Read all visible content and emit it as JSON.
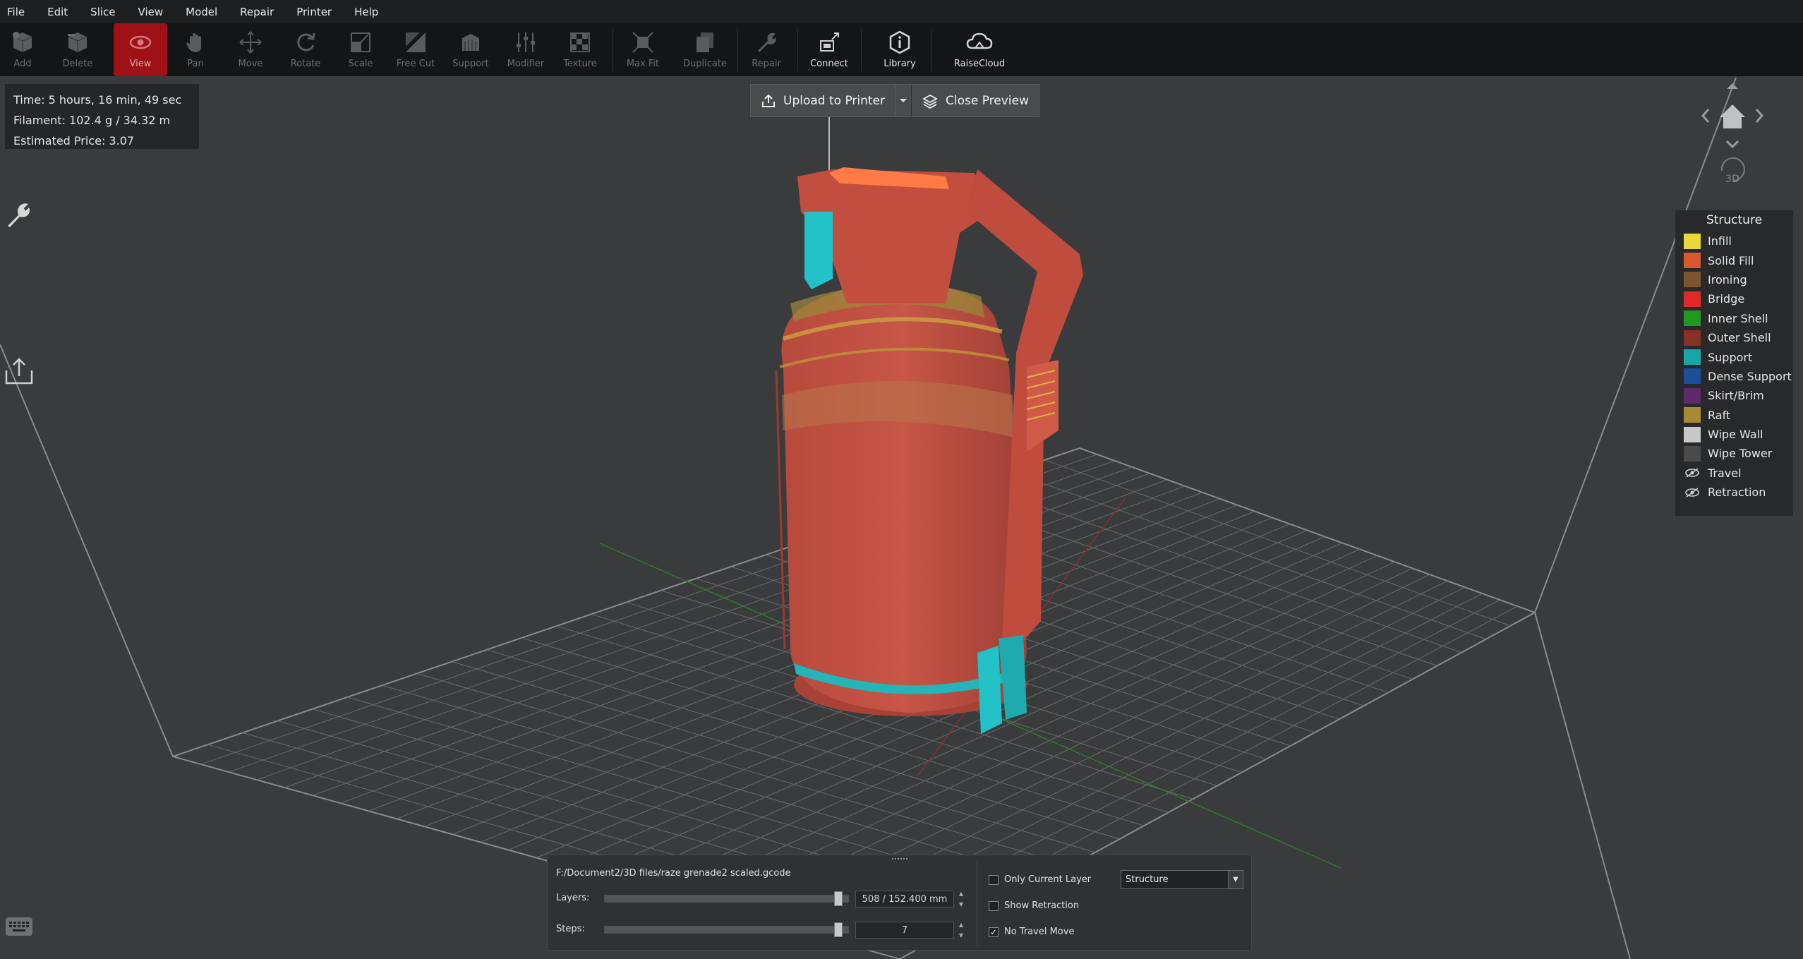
{
  "menu": [
    "File",
    "Edit",
    "Slice",
    "View",
    "Model",
    "Repair",
    "Printer",
    "Help"
  ],
  "toolbar": {
    "tools": [
      {
        "name": "add",
        "label": "Add",
        "icon": "add-cube-icon"
      },
      {
        "name": "delete",
        "label": "Delete",
        "icon": "delete-cube-icon"
      },
      {
        "name": "view",
        "label": "View",
        "icon": "eye-icon"
      },
      {
        "name": "pan",
        "label": "Pan",
        "icon": "hand-icon"
      },
      {
        "name": "move",
        "label": "Move",
        "icon": "move-arrows-icon"
      },
      {
        "name": "rotate",
        "label": "Rotate",
        "icon": "rotate-icon"
      },
      {
        "name": "scale",
        "label": "Scale",
        "icon": "scale-icon"
      },
      {
        "name": "free-cut",
        "label": "Free Cut",
        "icon": "cut-icon"
      },
      {
        "name": "support",
        "label": "Support",
        "icon": "support-icon"
      },
      {
        "name": "modifier",
        "label": "Modifier",
        "icon": "sliders-icon"
      },
      {
        "name": "texture",
        "label": "Texture",
        "icon": "texture-icon"
      },
      {
        "name": "max-fit",
        "label": "Max Fit",
        "icon": "max-fit-icon"
      },
      {
        "name": "duplicate",
        "label": "Duplicate",
        "icon": "duplicate-icon"
      },
      {
        "name": "repair",
        "label": "Repair",
        "icon": "wrench-icon"
      },
      {
        "name": "connect",
        "label": "Connect",
        "icon": "connect-icon"
      },
      {
        "name": "library",
        "label": "Library",
        "icon": "info-icon"
      },
      {
        "name": "raisecloud",
        "label": "RaiseCloud",
        "icon": "cloud-icon"
      }
    ]
  },
  "print_info": {
    "time": "Time: 5 hours, 16 min, 49 sec",
    "filament": "Filament: 102.4 g / 34.32 m",
    "price": "Estimated Price: 3.07"
  },
  "preview": {
    "upload_label": "Upload to Printer",
    "close_label": "Close Preview"
  },
  "nav": {
    "label_3d": "3D"
  },
  "legend": {
    "title": "Structure",
    "items": [
      {
        "label": "Infill",
        "color": "#e8d83a"
      },
      {
        "label": "Solid Fill",
        "color": "#d9582e"
      },
      {
        "label": "Ironing",
        "color": "#7a5530"
      },
      {
        "label": "Bridge",
        "color": "#e02a2a"
      },
      {
        "label": "Inner Shell",
        "color": "#1f9a1f"
      },
      {
        "label": "Outer Shell",
        "color": "#8a3127"
      },
      {
        "label": "Support",
        "color": "#1aa6a6"
      },
      {
        "label": "Dense Support",
        "color": "#1b4f9c"
      },
      {
        "label": "Skirt/Brim",
        "color": "#5e2a6a"
      },
      {
        "label": "Raft",
        "color": "#a88a35"
      },
      {
        "label": "Wipe Wall",
        "color": "#c8c8c8"
      },
      {
        "label": "Wipe Tower",
        "color": "#4a4a4a"
      }
    ],
    "toggles": [
      {
        "label": "Travel",
        "icon": "eye-hidden-icon"
      },
      {
        "label": "Retraction",
        "icon": "eye-hidden-icon"
      }
    ]
  },
  "bottom_panel": {
    "file_path": "F:/Document2/3D files/raze grenade2 scaled.gcode",
    "layers_label": "Layers:",
    "layers_value": "508 / 152.400 mm",
    "layers_progress": 1.0,
    "steps_label": "Steps:",
    "steps_value": "7",
    "steps_progress": 1.0,
    "only_current_layer": {
      "label": "Only Current Layer",
      "checked": false
    },
    "show_retraction": {
      "label": "Show Retraction",
      "checked": false
    },
    "no_travel_move": {
      "label": "No Travel Move",
      "checked": true
    },
    "view_mode": "Structure"
  }
}
